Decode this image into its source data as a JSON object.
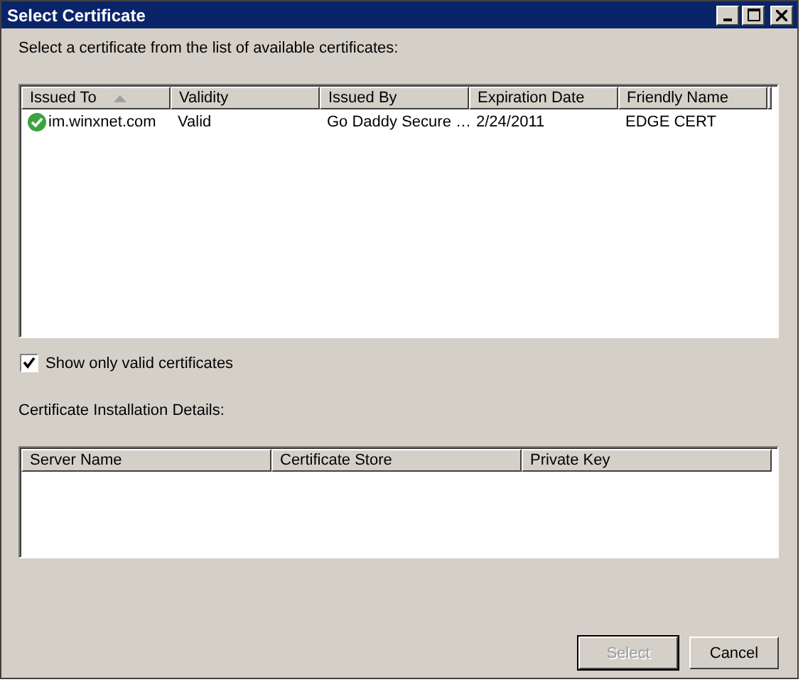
{
  "window": {
    "title": "Select Certificate"
  },
  "instruction": "Select a certificate from the list of available certificates:",
  "certificates": {
    "columns": [
      {
        "label": "Issued To",
        "sorted": true
      },
      {
        "label": "Validity",
        "sorted": false
      },
      {
        "label": "Issued By",
        "sorted": false
      },
      {
        "label": "Expiration Date",
        "sorted": false
      },
      {
        "label": "Friendly Name",
        "sorted": false
      }
    ],
    "rows": [
      {
        "valid": true,
        "cells": [
          "im.winxnet.com",
          "Valid",
          "Go Daddy Secure …",
          "2/24/2011",
          "EDGE CERT"
        ]
      }
    ]
  },
  "show_only_valid": {
    "label": "Show only valid certificates",
    "checked": true
  },
  "details_label": "Certificate Installation Details:",
  "details": {
    "columns": [
      "Server Name",
      "Certificate Store",
      "Private Key"
    ]
  },
  "buttons": [
    {
      "label": "Select",
      "disabled": true
    },
    {
      "label": "Cancel",
      "disabled": false
    }
  ]
}
